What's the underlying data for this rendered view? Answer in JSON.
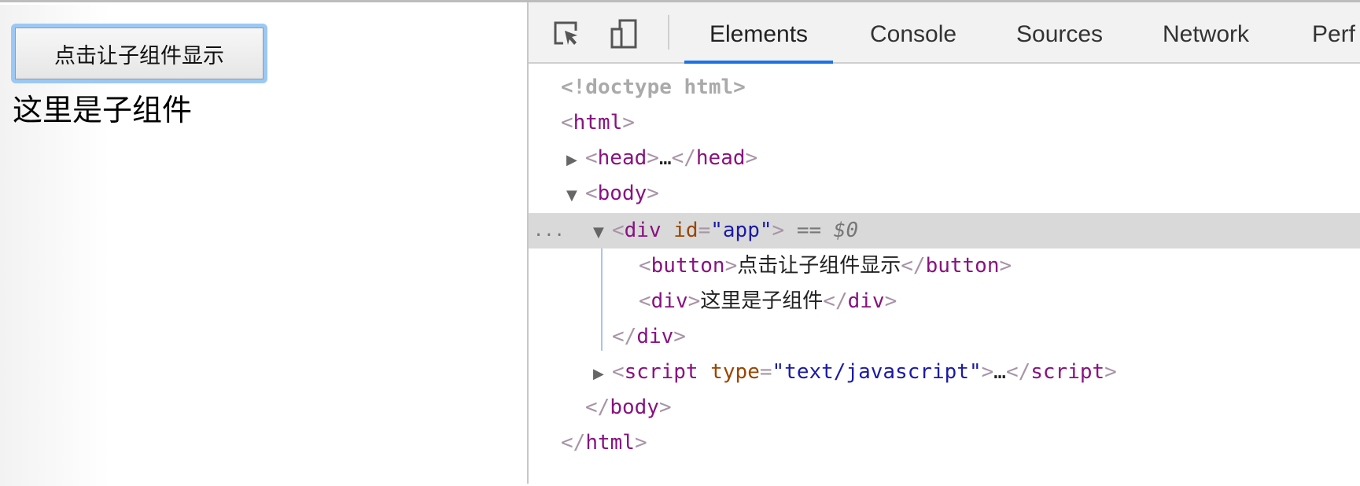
{
  "page": {
    "button_label": "点击让子组件显示",
    "child_text": "这里是子组件"
  },
  "devtools": {
    "icons": [
      "inspect-element-icon",
      "device-toolbar-icon"
    ],
    "tabs": [
      {
        "label": "Elements",
        "active": true
      },
      {
        "label": "Console"
      },
      {
        "label": "Sources"
      },
      {
        "label": "Network"
      },
      {
        "label": "Perf"
      }
    ],
    "dom": {
      "doctype": "<!doctype html>",
      "html_open": "html",
      "head": "head",
      "ellipsis": "…",
      "body": "body",
      "div": "div",
      "id_attr": "id",
      "id_val": "\"app\"",
      "selected_marker": "== $0",
      "dots": "...",
      "button": "button",
      "button_text": "点击让子组件显示",
      "child_text": "这里是子组件",
      "script": "script",
      "type_attr": "type",
      "type_val": "\"text/javascript\""
    }
  }
}
